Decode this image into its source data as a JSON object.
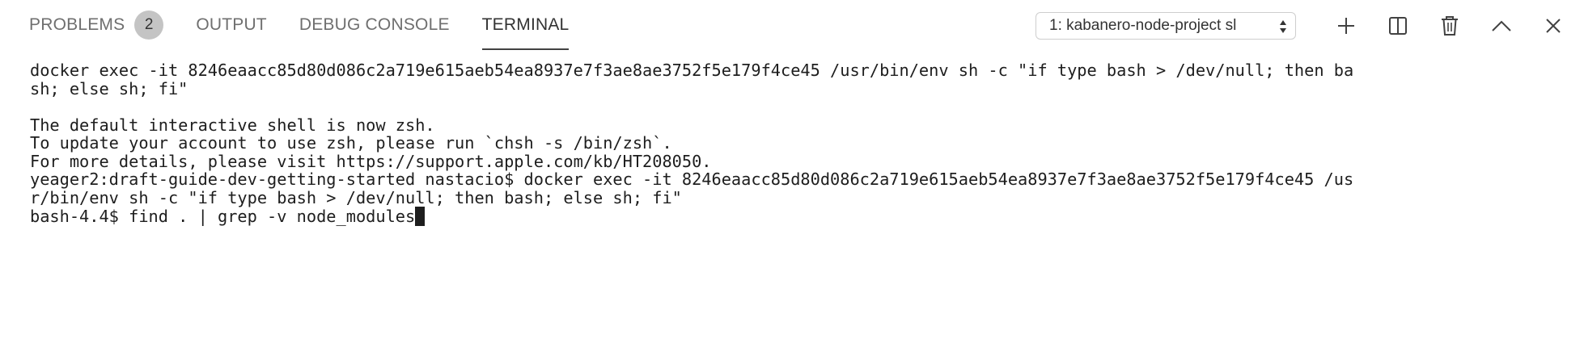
{
  "panel": {
    "tabs": [
      {
        "label": "PROBLEMS",
        "badge": "2"
      },
      {
        "label": "OUTPUT"
      },
      {
        "label": "DEBUG CONSOLE"
      },
      {
        "label": "TERMINAL",
        "active": true
      }
    ],
    "terminal_select": {
      "selected": "1: kabanero-node-project sl"
    },
    "icons": [
      "plus-icon",
      "split-icon",
      "trash-icon",
      "chevron-up-icon",
      "close-icon"
    ]
  },
  "terminal": {
    "lines": [
      "docker exec -it 8246eaacc85d80d086c2a719e615aeb54ea8937e7f3ae8ae3752f5e179f4ce45 /usr/bin/env sh -c \"if type bash > /dev/null; then ba",
      "sh; else sh; fi\"",
      "",
      "The default interactive shell is now zsh.",
      "To update your account to use zsh, please run `chsh -s /bin/zsh`.",
      "For more details, please visit https://support.apple.com/kb/HT208050.",
      "yeager2:draft-guide-dev-getting-started nastacio$ docker exec -it 8246eaacc85d80d086c2a719e615aeb54ea8937e7f3ae8ae3752f5e179f4ce45 /us",
      "r/bin/env sh -c \"if type bash > /dev/null; then bash; else sh; fi\"",
      "bash-4.4$ find . | grep -v node_modules"
    ]
  }
}
